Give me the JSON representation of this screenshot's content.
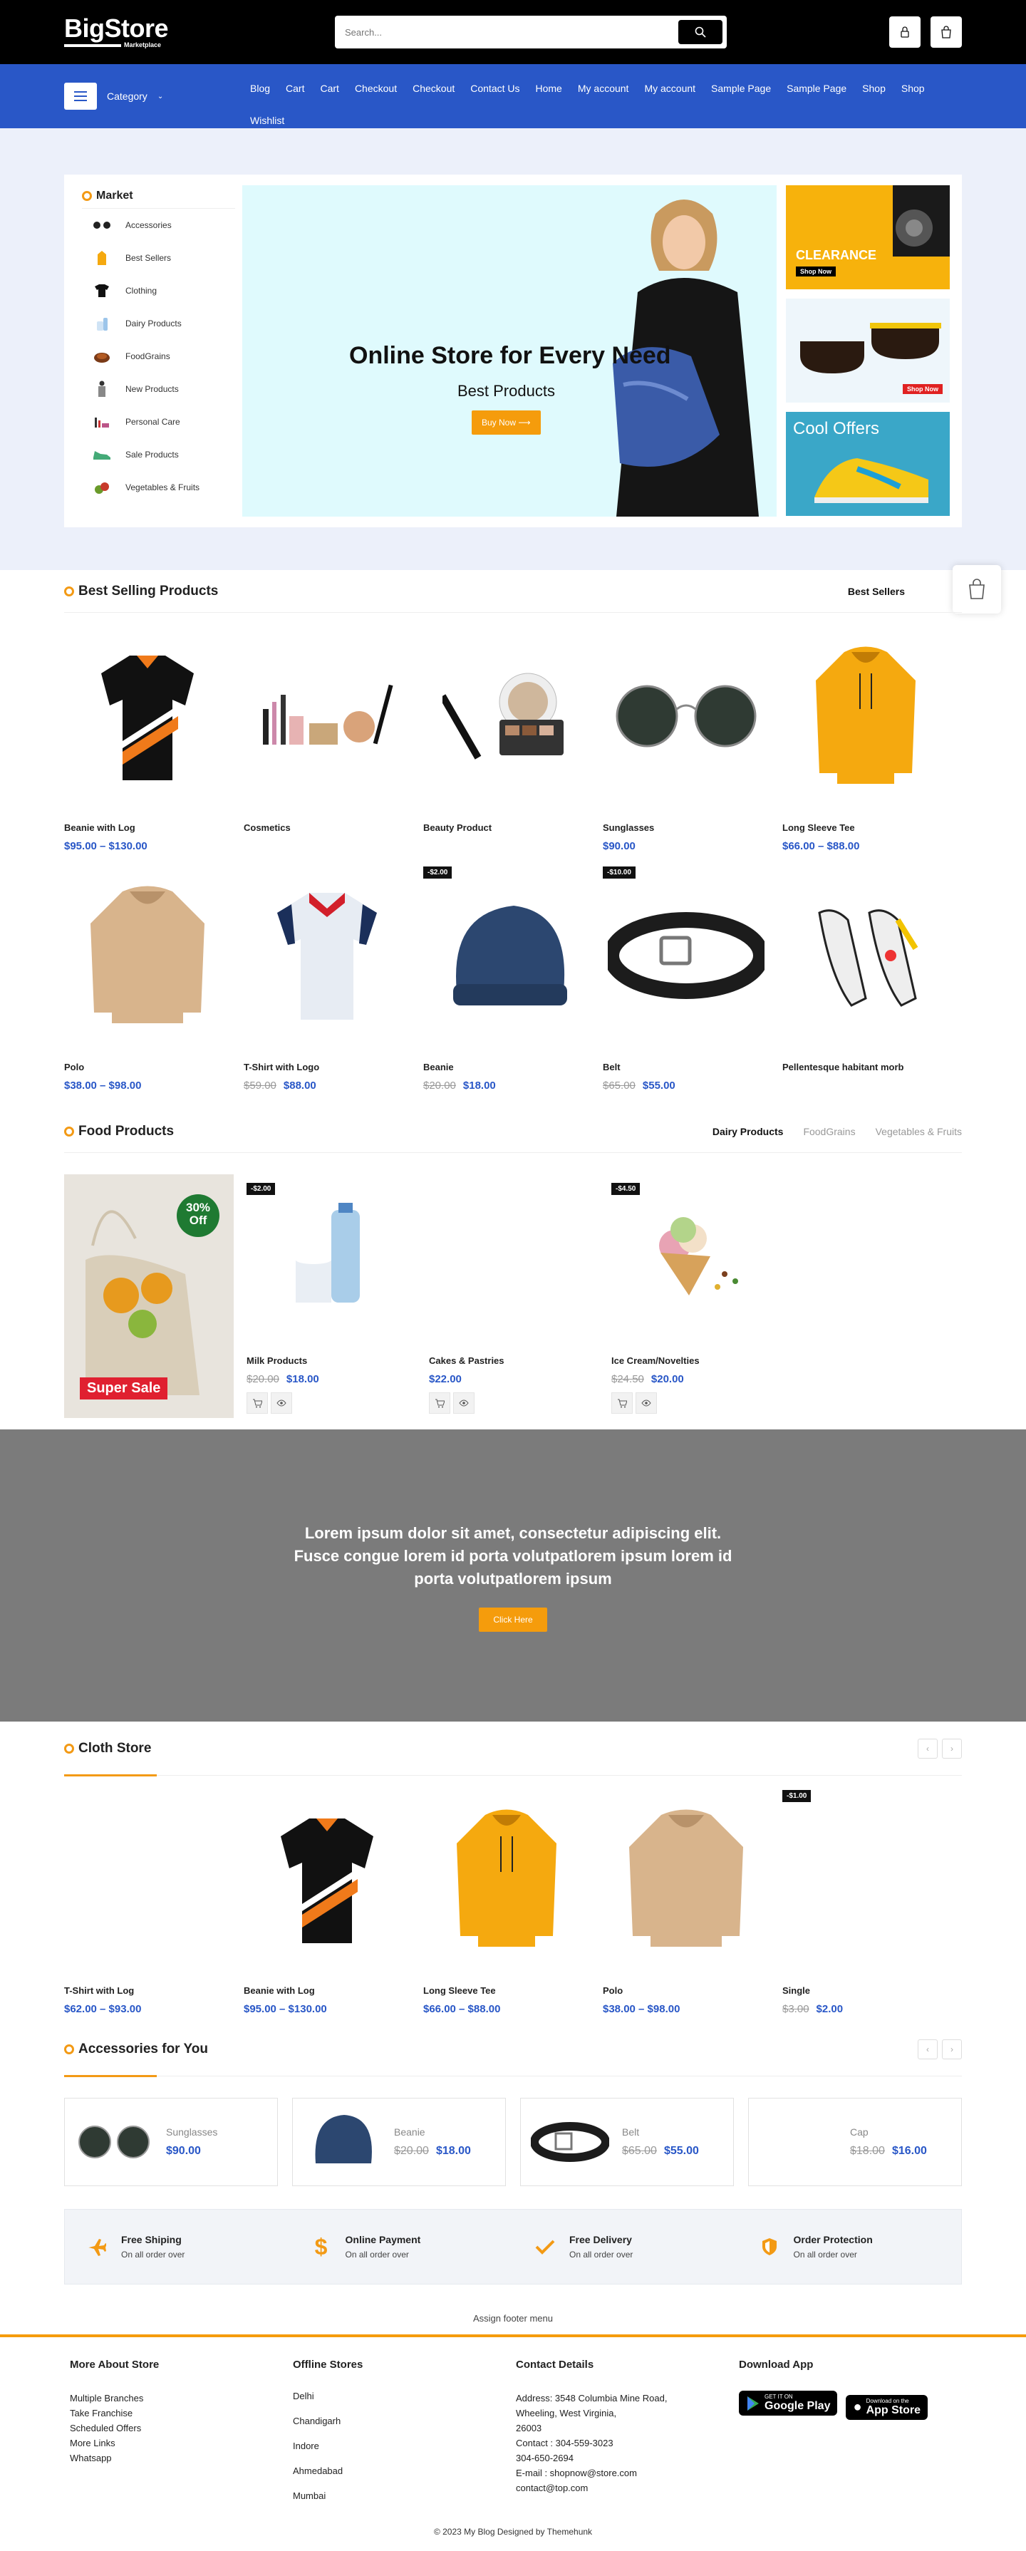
{
  "header": {
    "logo_main": "BigStore",
    "logo_sub": "Marketplace",
    "search_placeholder": "Search..."
  },
  "nav": {
    "category_label": "Category",
    "links": [
      "Blog",
      "Cart",
      "Cart",
      "Checkout",
      "Checkout",
      "Contact Us",
      "Home",
      "My account",
      "My account",
      "Sample Page",
      "Sample Page",
      "Shop",
      "Shop",
      "Wishlist"
    ]
  },
  "market": {
    "title": "Market",
    "items": [
      "Accessories",
      "Best Sellers",
      "Clothing",
      "Dairy Products",
      "FoodGrains",
      "New Products",
      "Personal Care",
      "Sale Products",
      "Vegetables & Fruits"
    ]
  },
  "hero": {
    "title": "Online Store for Every Need",
    "subtitle": "Best Products",
    "button": "Buy Now",
    "banner1_title": "CLEARANCE",
    "banner1_btn": "Shop Now",
    "banner2_btn": "Shop Now",
    "banner3_title": "Cool Offers"
  },
  "best_selling": {
    "title": "Best Selling Products",
    "tab": "Best Sellers",
    "products": [
      {
        "name": "Beanie with Log",
        "price": "$95.00 – $130.00",
        "old": "",
        "badge": ""
      },
      {
        "name": "Cosmetics",
        "price": "",
        "old": "",
        "badge": ""
      },
      {
        "name": "Beauty Product",
        "price": "",
        "old": "",
        "badge": ""
      },
      {
        "name": "Sunglasses",
        "price": "$90.00",
        "old": "",
        "badge": ""
      },
      {
        "name": "Long Sleeve Tee",
        "price": "$66.00 – $88.00",
        "old": "",
        "badge": ""
      },
      {
        "name": "Polo",
        "price": "$38.00 – $98.00",
        "old": "",
        "badge": ""
      },
      {
        "name": "T-Shirt with Logo",
        "price": "$88.00",
        "old": "$59.00",
        "badge": ""
      },
      {
        "name": "Beanie",
        "price": "$18.00",
        "old": "$20.00",
        "badge": "-$2.00"
      },
      {
        "name": "Belt",
        "price": "$55.00",
        "old": "$65.00",
        "badge": "-$10.00"
      },
      {
        "name": "Pellentesque habitant morb",
        "price": "",
        "old": "",
        "badge": ""
      }
    ]
  },
  "food": {
    "title": "Food Products",
    "tabs": [
      "Dairy Products",
      "FoodGrains",
      "Vegetables & Fruits"
    ],
    "banner_off": "30%",
    "banner_off2": "Off",
    "banner_sale": "Super Sale",
    "products": [
      {
        "name": "Milk Products",
        "price": "$18.00",
        "old": "$20.00",
        "badge": "-$2.00"
      },
      {
        "name": "Cakes & Pastries",
        "price": "$22.00",
        "old": "",
        "badge": ""
      },
      {
        "name": "Ice Cream/Novelties",
        "price": "$20.00",
        "old": "$24.50",
        "badge": "-$4.50"
      }
    ]
  },
  "cta": {
    "text": "Lorem ipsum dolor sit amet, consectetur adipiscing elit. Fusce congue lorem id porta volutpatlorem ipsum lorem id porta volutpatlorem ipsum",
    "button": "Click Here"
  },
  "cloth": {
    "title": "Cloth Store",
    "products": [
      {
        "name": "T-Shirt with Log",
        "price": "$62.00 – $93.00",
        "old": "",
        "badge": ""
      },
      {
        "name": "Beanie with Log",
        "price": "$95.00 – $130.00",
        "old": "",
        "badge": ""
      },
      {
        "name": "Long Sleeve Tee",
        "price": "$66.00 – $88.00",
        "old": "",
        "badge": ""
      },
      {
        "name": "Polo",
        "price": "$38.00 – $98.00",
        "old": "",
        "badge": ""
      },
      {
        "name": "Single",
        "price": "$2.00",
        "old": "$3.00",
        "badge": "-$1.00"
      }
    ]
  },
  "accessories": {
    "title": "Accessories for You",
    "items": [
      {
        "name": "Sunglasses",
        "price": "$90.00",
        "old": ""
      },
      {
        "name": "Beanie",
        "price": "$18.00",
        "old": "$20.00"
      },
      {
        "name": "Belt",
        "price": "$55.00",
        "old": "$65.00"
      },
      {
        "name": "Cap",
        "price": "$16.00",
        "old": "$18.00"
      }
    ]
  },
  "features": [
    {
      "title": "Free Shiping",
      "sub": "On all order over"
    },
    {
      "title": "Online Payment",
      "sub": "On all order over"
    },
    {
      "title": "Free Delivery",
      "sub": "On all order over"
    },
    {
      "title": "Order Protection",
      "sub": "On all order over"
    }
  ],
  "footer": {
    "menu_note": "Assign footer menu",
    "col1_title": "More About Store",
    "col1_items": [
      "Multiple Branches",
      "Take Franchise",
      "Scheduled Offers",
      "More Links",
      "Whatsapp"
    ],
    "col2_title": "Offline Stores",
    "col2_items": [
      "Delhi",
      "Chandigarh",
      "Indore",
      "Ahmedabad",
      "Mumbai"
    ],
    "col3_title": "Contact Details",
    "col3_items": [
      "Address: 3548 Columbia Mine Road,",
      "Wheeling, West Virginia,",
      "26003",
      "Contact : 304-559-3023",
      "304-650-2694",
      "E-mail : shopnow@store.com",
      "contact@top.com"
    ],
    "col4_title": "Download App",
    "gplay_small": "GET IT ON",
    "gplay_big": "Google Play",
    "appstore_small": "Download on the",
    "appstore_big": "App Store",
    "copyright": "© 2023 My Blog Designed by Themehunk"
  },
  "colors": {
    "accent": "#f39a15",
    "brand": "#2957c7",
    "topbar": "#000000"
  }
}
